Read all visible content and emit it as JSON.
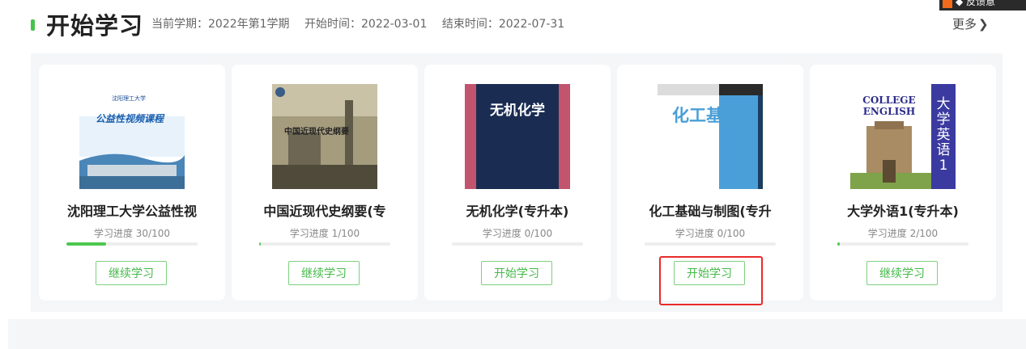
{
  "header": {
    "title": "开始学习",
    "term_label": "当前学期：2022年第1学期",
    "start_label": "开始时间：2022-03-01",
    "end_label": "结束时间：2022-07-31",
    "more_label": "更多",
    "more_icon": "chevron-right-icon"
  },
  "corner_widget": {
    "label": "◆ 反馈意"
  },
  "courses": [
    {
      "name": "沈阳理工大学公益性视",
      "progress_label": "学习进度 30/100",
      "progress": 0.3,
      "action_label": "继续学习",
      "cover": {
        "caption": "公益性视频课程",
        "header_text": "沈阳理工大学"
      }
    },
    {
      "name": "中国近现代史纲要(专",
      "progress_label": "学习进度 1/100",
      "progress": 0.01,
      "action_label": "继续学习",
      "cover": {
        "caption": "中国近现代史纲要"
      }
    },
    {
      "name": "无机化学(专升本)",
      "progress_label": "学习进度 0/100",
      "progress": 0.0,
      "action_label": "开始学习",
      "cover": {
        "caption": "无机化学"
      }
    },
    {
      "name": "化工基础与制图(专升",
      "progress_label": "学习进度 0/100",
      "progress": 0.0,
      "action_label": "开始学习",
      "cover": {
        "caption": "化工基础"
      }
    },
    {
      "name": "大学外语1(专升本)",
      "progress_label": "学习进度 2/100",
      "progress": 0.02,
      "action_label": "继续学习",
      "cover": {
        "line1": "COLLEGE",
        "line2": "ENGLISH",
        "side": "大学英语1"
      }
    }
  ],
  "colors": {
    "accent": "#44c34c",
    "highlight": "#e82a2a"
  }
}
